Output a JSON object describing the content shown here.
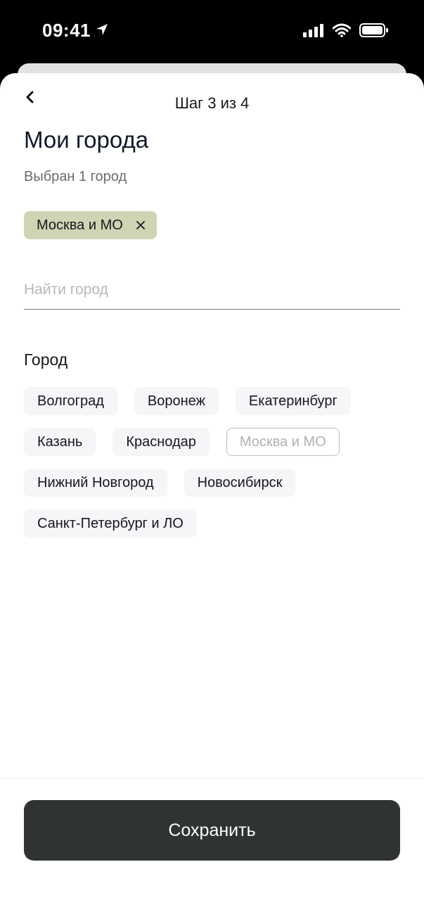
{
  "status_bar": {
    "time": "09:41",
    "icons": [
      "location-arrow-icon",
      "cellular-signal-icon",
      "wifi-icon",
      "battery-icon"
    ]
  },
  "header": {
    "back_icon": "chevron-left-icon",
    "step": "Шаг 3 из 4"
  },
  "title": "Мои города",
  "subtitle": "Выбран 1 город",
  "selected": {
    "label": "Москва и МО",
    "remove_icon": "close-icon"
  },
  "search": {
    "placeholder": "Найти город",
    "value": ""
  },
  "section": {
    "label": "Город",
    "cities": [
      {
        "label": "Волгоград",
        "selected": false
      },
      {
        "label": "Воронеж",
        "selected": false
      },
      {
        "label": "Екатеринбург",
        "selected": false
      },
      {
        "label": "Казань",
        "selected": false
      },
      {
        "label": "Краснодар",
        "selected": false
      },
      {
        "label": "Москва и МО",
        "selected": true
      },
      {
        "label": "Нижний Новгород",
        "selected": false
      },
      {
        "label": "Новосибирск",
        "selected": false
      },
      {
        "label": "Санкт-Петербург и ЛО",
        "selected": false
      }
    ]
  },
  "footer": {
    "save_label": "Сохранить"
  },
  "colors": {
    "selected_chip_bg": "#cfd4b4",
    "button_bg": "#2f3333",
    "chip_bg": "#f6f5f8"
  }
}
